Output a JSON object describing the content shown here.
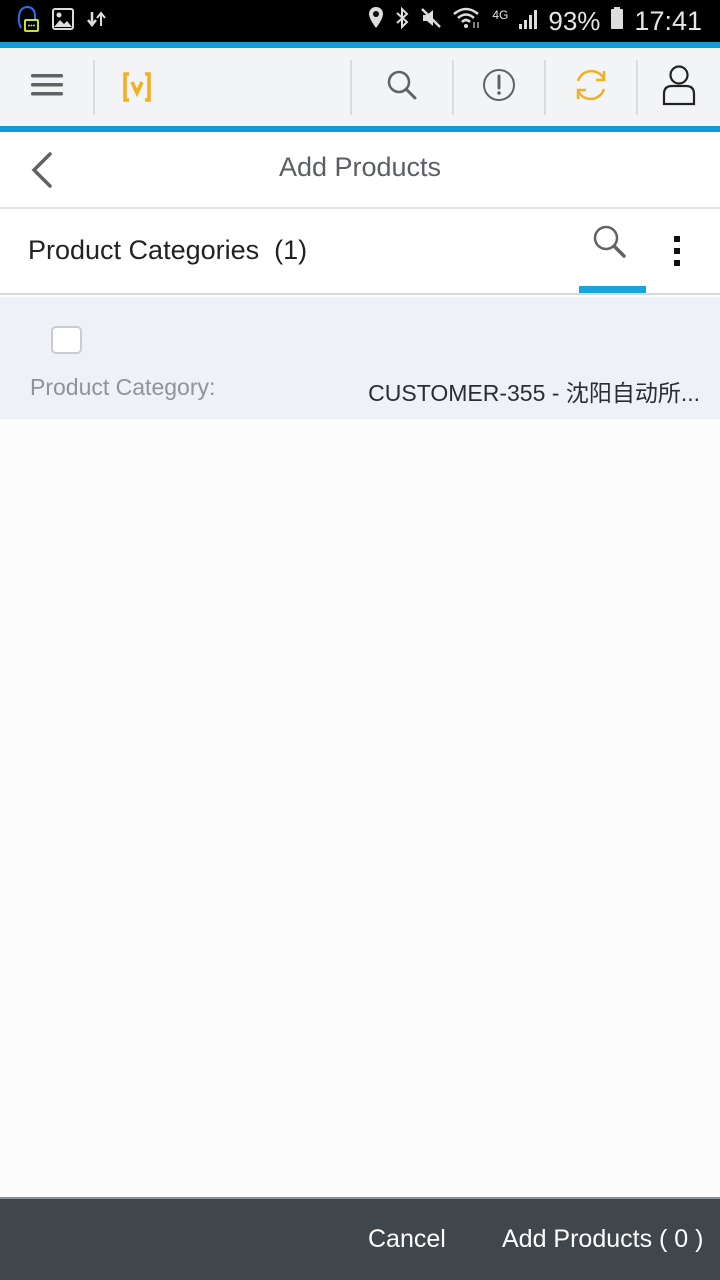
{
  "status_bar": {
    "left_icons": [
      "assistant-notification-icon",
      "gallery-icon",
      "data-transfer-icon"
    ],
    "right_icons": [
      "location-icon",
      "bluetooth-icon",
      "mute-icon",
      "wifi-icon",
      "signal-icon",
      "battery-icon"
    ],
    "network": "4G",
    "battery": "93%",
    "time": "17:41"
  },
  "topbar": {
    "icons": [
      "menu-icon",
      "app-logo",
      "search-icon",
      "alert-icon",
      "sync-icon",
      "user-icon"
    ],
    "accent_color": "#f2b01e",
    "brand_line_color": "#139bd8"
  },
  "header": {
    "title": "Add Products"
  },
  "subheader": {
    "label": "Product Categories",
    "count": "(1)"
  },
  "list": {
    "items": [
      {
        "checked": false,
        "label": "Product Category:",
        "value": "CUSTOMER-355 - 沈阳自动所..."
      }
    ]
  },
  "footer": {
    "cancel_label": "Cancel",
    "add_label": "Add Products ( 0 )"
  }
}
